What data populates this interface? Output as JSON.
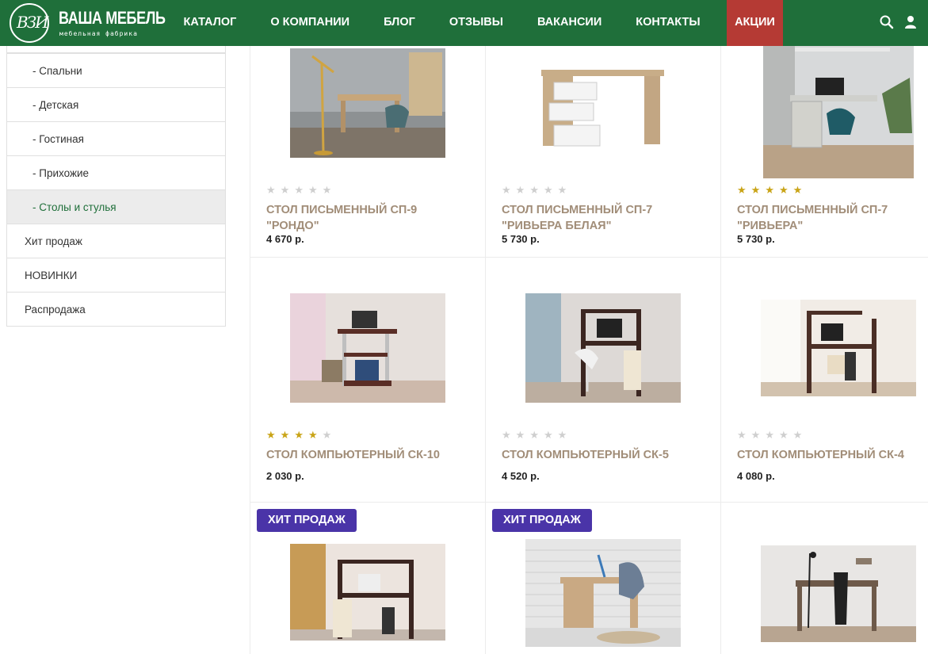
{
  "header": {
    "logo_mark": "ВЗИ",
    "logo_title": "ВАША МЕБЕЛЬ",
    "logo_subtitle": "мебельная  фабрика",
    "nav": [
      "КАТАЛОГ",
      "О КОМПАНИИ",
      "БЛОГ",
      "ОТЗЫВЫ",
      "ВАКАНСИИ",
      "КОНТАКТЫ"
    ],
    "promo": "АКЦИИ",
    "colors": {
      "header_bg": "#1f6f3a",
      "promo_bg": "#b53a34"
    },
    "icons": [
      "search-icon",
      "user-icon"
    ]
  },
  "sidebar": {
    "items": [
      {
        "label": "- Спальни",
        "level": "sub",
        "active": false
      },
      {
        "label": "- Детская",
        "level": "sub",
        "active": false
      },
      {
        "label": "- Гостиная",
        "level": "sub",
        "active": false
      },
      {
        "label": "- Прихожие",
        "level": "sub",
        "active": false
      },
      {
        "label": "- Столы и стулья",
        "level": "sub",
        "active": true
      },
      {
        "label": "Хит продаж",
        "level": "top",
        "active": false
      },
      {
        "label": "НОВИНКИ",
        "level": "top",
        "active": false
      },
      {
        "label": "Распродажа",
        "level": "top",
        "active": false
      }
    ]
  },
  "products": [
    {
      "name": "СТОЛ ПИСЬМЕННЫЙ СП-9 \"РОНДО\"",
      "price": "4 670 р.",
      "rating": 0
    },
    {
      "name": "СТОЛ ПИСЬМЕННЫЙ СП-7 \"РИВЬЕРА БЕЛАЯ\"",
      "price": "5 730 р.",
      "rating": 0
    },
    {
      "name": "СТОЛ ПИСЬМЕННЫЙ СП-7 \"РИВЬЕРА\"",
      "price": "5 730 р.",
      "rating": 5
    },
    {
      "name": "СТОЛ КОМПЬЮТЕРНЫЙ СК-10",
      "price": "2 030 р.",
      "rating": 4
    },
    {
      "name": "СТОЛ КОМПЬЮТЕРНЫЙ СК-5",
      "price": "4 520 р.",
      "rating": 0
    },
    {
      "name": "СТОЛ КОМПЬЮТЕРНЫЙ СК-4",
      "price": "4 080 р.",
      "rating": 0
    },
    {
      "badge": "ХИТ ПРОДАЖ"
    },
    {
      "badge": "ХИТ ПРОДАЖ"
    },
    {}
  ],
  "colors": {
    "star_on": "#c9a417",
    "star_off": "#cfcfcf",
    "product_name": "#a18d78",
    "badge_bg": "#4a34a8",
    "active_side": "#1f6f3a"
  }
}
